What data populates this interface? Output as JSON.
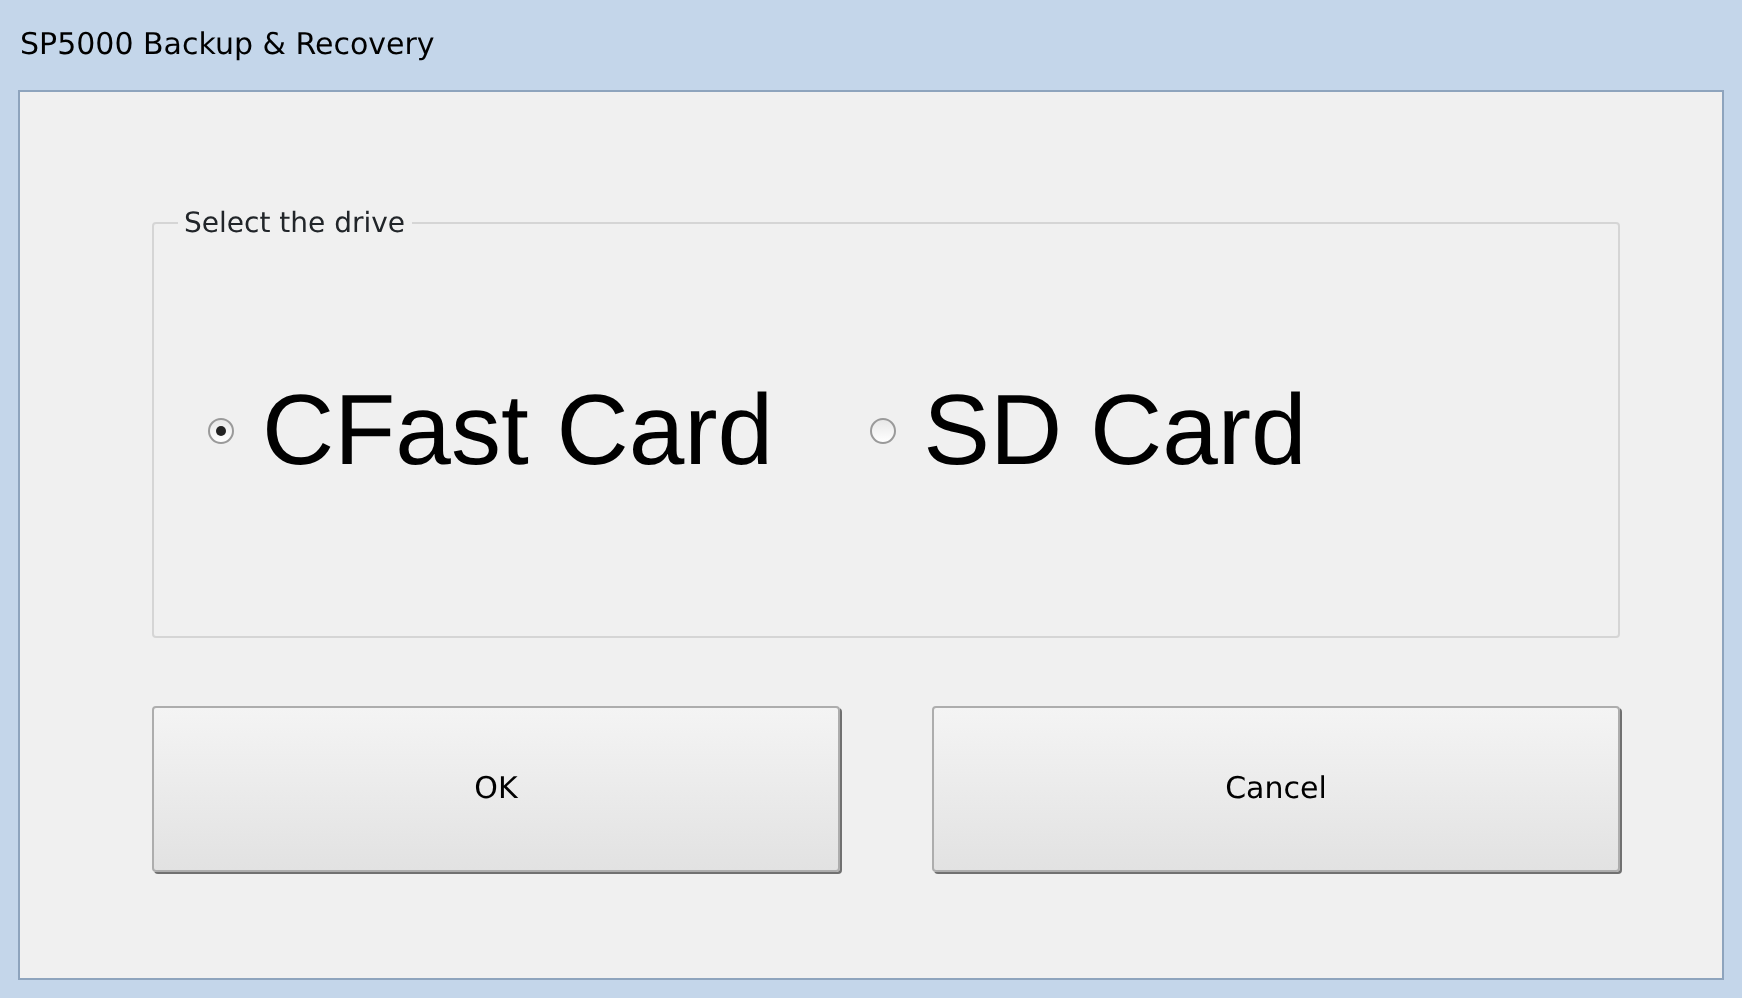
{
  "window": {
    "title": "SP5000 Backup & Recovery"
  },
  "group": {
    "label": "Select the drive",
    "options": [
      {
        "label": "CFast Card",
        "selected": true
      },
      {
        "label": "SD Card",
        "selected": false
      }
    ]
  },
  "buttons": [
    {
      "label": "OK"
    },
    {
      "label": "Cancel"
    }
  ]
}
